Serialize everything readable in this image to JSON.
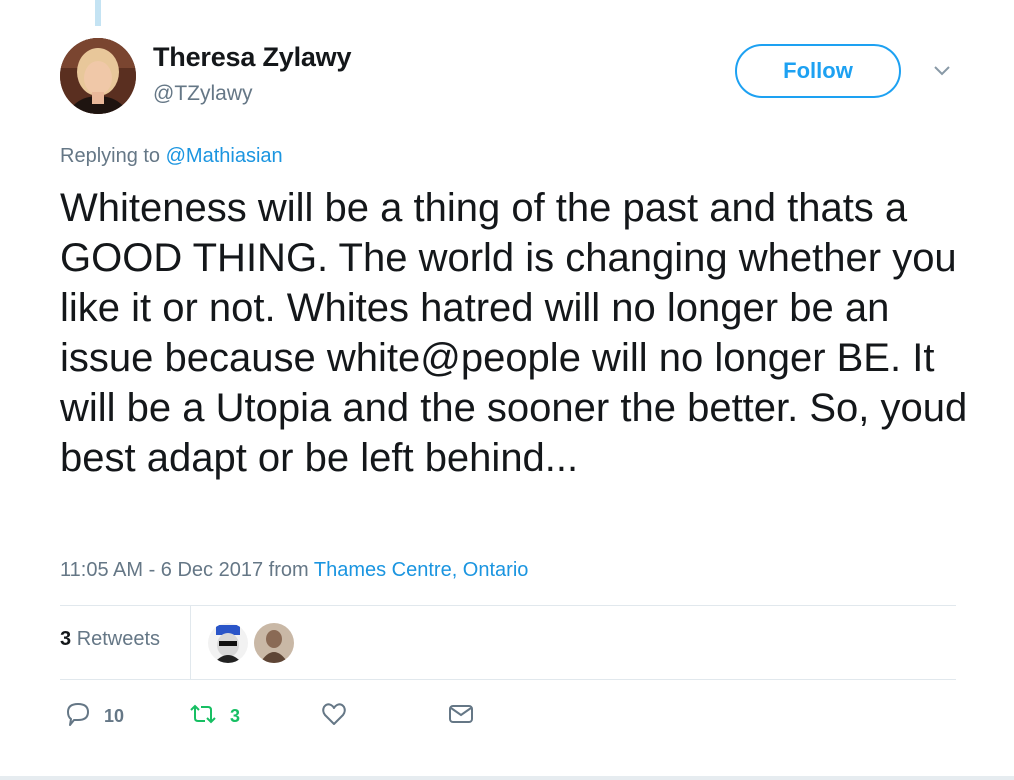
{
  "author": {
    "name": "Theresa Zylawy",
    "handle": "@TZylawy"
  },
  "follow_button": {
    "label": "Follow"
  },
  "reply_context": {
    "prefix": "Replying to",
    "mention": "@Mathiasian"
  },
  "tweet": {
    "text": "Whiteness will be a thing of the past and thats a GOOD THING. The world is changing whether you like it or not. Whites hatred will no longer be an issue because white@people will no longer BE. It will be a Utopia and the sooner the better. So, youd best adapt or be left behind...",
    "timestamp": "11:05 AM - 6 Dec 2017 from",
    "location": "Thames Centre, Ontario"
  },
  "stats": {
    "retweet_count": "3",
    "retweet_label": "Retweets"
  },
  "actions": {
    "reply_count": "10",
    "retweet_count": "3",
    "icons": [
      "reply-icon",
      "retweet-icon",
      "like-icon",
      "direct-message-icon"
    ]
  },
  "colors": {
    "accent": "#1da1f2",
    "link": "#1b95e0",
    "muted": "#657786",
    "retweet_green": "#17bf63",
    "text": "#14171a"
  }
}
